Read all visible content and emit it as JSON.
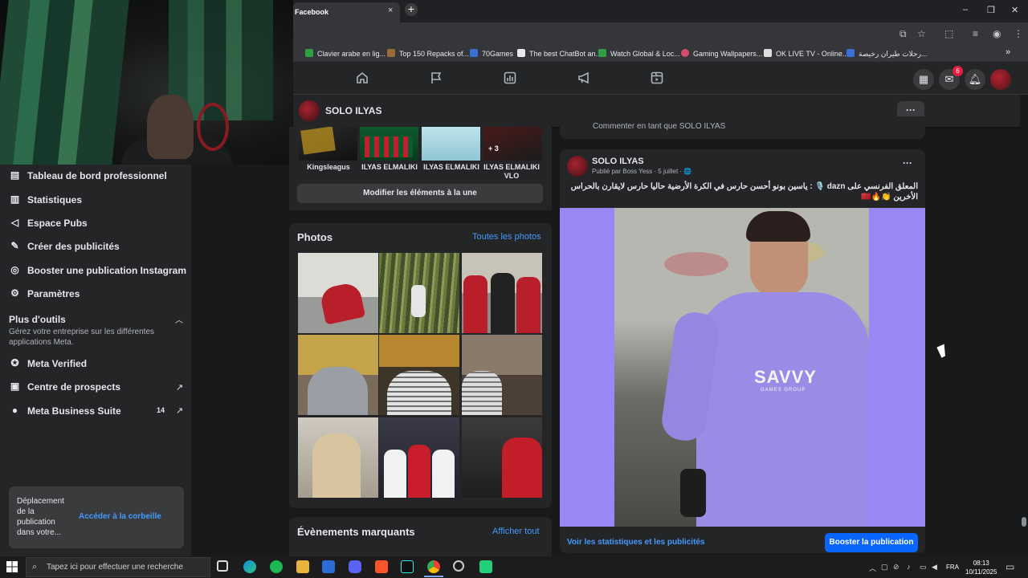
{
  "browser": {
    "tab_title": "Facebook",
    "tab_close": "×",
    "new_tab": "+",
    "window_controls": {
      "minimize": "–",
      "restore": "❐",
      "close": "✕"
    },
    "bookmarks": [
      {
        "label": "Clavier arabe en lig...",
        "color": "#2ea043"
      },
      {
        "label": "Top 150 Repacks of...",
        "color": "#9a6b3a"
      },
      {
        "label": "70Games",
        "color": "#3b6fd8"
      },
      {
        "label": "The best ChatBot an...",
        "color": "#e8eaed"
      },
      {
        "label": "Watch Global & Loc...",
        "color": "#2ea043"
      },
      {
        "label": "Gaming Wallpapers...",
        "color": "#d94b6a"
      },
      {
        "label": "OK LIVE TV - Online...",
        "color": "#dddddd"
      },
      {
        "label": "رحلات طيران رخيصة...",
        "color": "#3b6fd8"
      }
    ],
    "bookmarks_more": "»"
  },
  "fb_header": {
    "nav_icons": [
      "home-icon",
      "flag-icon",
      "dashboard-icon",
      "megaphone-icon",
      "reels-icon"
    ],
    "messenger_badge": "6"
  },
  "page_header": {
    "name": "SOLO ILYAS",
    "more": "···"
  },
  "sidebar": {
    "items": [
      {
        "label": "Tableau de bord professionnel",
        "icon": "dashboard-icon"
      },
      {
        "label": "Statistiques",
        "icon": "insights-icon"
      },
      {
        "label": "Espace Pubs",
        "icon": "megaphone-icon"
      },
      {
        "label": "Créer des publicités",
        "icon": "create-ad-icon"
      },
      {
        "label": "Booster une publication Instagram",
        "icon": "instagram-icon"
      },
      {
        "label": "Paramètres",
        "icon": "gear-icon"
      }
    ],
    "more_tools": {
      "title": "Plus d'outils",
      "description": "Gérez votre entreprise sur les différentes applications Meta."
    },
    "tools": [
      {
        "label": "Meta Verified",
        "icon": "verified-icon"
      },
      {
        "label": "Centre de prospects",
        "icon": "leads-icon"
      },
      {
        "label": "Meta Business Suite",
        "icon": "business-suite-icon",
        "count": "14"
      }
    ],
    "toast": {
      "text": "Déplacement de la publication dans votre...",
      "action": "Accéder à la corbeille"
    }
  },
  "featured": {
    "items": [
      {
        "caption": "Kingsleagus"
      },
      {
        "caption": "ILYAS ELMALIKI"
      },
      {
        "caption": "ILYAS ELMALIKI"
      },
      {
        "caption": "ILYAS ELMALIKI VLO",
        "overlay": "+ 3"
      }
    ],
    "modify_button": "Modifier les éléments à la une"
  },
  "photos": {
    "title": "Photos",
    "link": "Toutes les photos",
    "count": 9
  },
  "events": {
    "title": "Évènements marquants",
    "link": "Afficher tout"
  },
  "post": {
    "comment_placeholder": "Commenter en tant que SOLO ILYAS",
    "author": "SOLO ILYAS",
    "meta": "Publié par Boss Yess · 5 juillet · 🌐",
    "text": "المعلق الفرنسي على dazn 🎙️ : ياسين بونو أحسن حارس في الكرة الأرضية حاليا حارس لايقارن بالحراس الأخرين 👏🔥🇲🇦",
    "more": "···",
    "image_text": "SAVVY",
    "image_subtext": "GAMES GROUP",
    "stats_link": "Voir les statistiques et les publicités",
    "boost_button": "Booster la publication"
  },
  "taskbar": {
    "search_placeholder": "Tapez ici pour effectuer une recherche",
    "language": "FRA",
    "time": "08:13",
    "date": "10/11/2025"
  }
}
